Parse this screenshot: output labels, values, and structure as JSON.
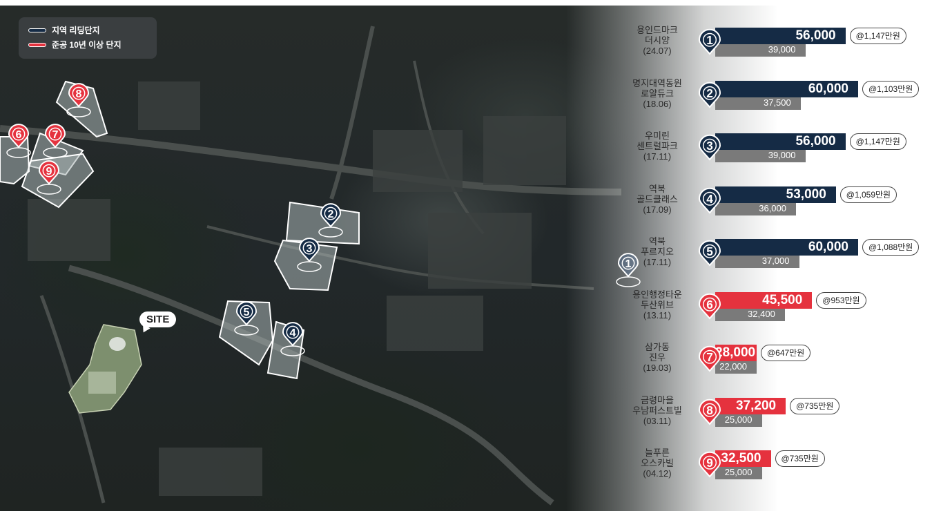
{
  "legend": {
    "items": [
      {
        "label": "지역 리딩단지",
        "color": "#152b45"
      },
      {
        "label": "준공 10년 이상 단지",
        "color": "#e5323e"
      }
    ]
  },
  "site_label": "SITE",
  "complexes": [
    {
      "num": "1",
      "name_lines": [
        "용인드마크",
        "더시양",
        "(24.07)"
      ],
      "price": "56,000",
      "sub": "39,000",
      "per_pyeong": "@1,147만원",
      "color": "navy"
    },
    {
      "num": "2",
      "name_lines": [
        "명지대역동원",
        "로얄듀크",
        "(18.06)"
      ],
      "price": "60,000",
      "sub": "37,500",
      "per_pyeong": "@1,103만원",
      "color": "navy"
    },
    {
      "num": "3",
      "name_lines": [
        "우미린",
        "센트럴파크",
        "(17.11)"
      ],
      "price": "56,000",
      "sub": "39,000",
      "per_pyeong": "@1,147만원",
      "color": "navy"
    },
    {
      "num": "4",
      "name_lines": [
        "역북",
        "골드클래스",
        "(17.09)"
      ],
      "price": "53,000",
      "sub": "36,000",
      "per_pyeong": "@1,059만원",
      "color": "navy"
    },
    {
      "num": "5",
      "name_lines": [
        "역북",
        "푸르지오",
        "(17.11)"
      ],
      "price": "60,000",
      "sub": "37,000",
      "per_pyeong": "@1,088만원",
      "color": "navy"
    },
    {
      "num": "6",
      "name_lines": [
        "용인행정타운",
        "두산위브",
        "(13.11)"
      ],
      "price": "45,500",
      "sub": "32,400",
      "per_pyeong": "@953만원",
      "color": "red"
    },
    {
      "num": "7",
      "name_lines": [
        "삼가동",
        "진우",
        "(19.03)"
      ],
      "price": "28,000",
      "sub": "22,000",
      "per_pyeong": "@647만원",
      "color": "red"
    },
    {
      "num": "8",
      "name_lines": [
        "금령마을",
        "우남퍼스트빌",
        "(03.11)"
      ],
      "price": "37,200",
      "sub": "25,000",
      "per_pyeong": "@735만원",
      "color": "red"
    },
    {
      "num": "9",
      "name_lines": [
        "늘푸른",
        "오스카빌",
        "(04.12)"
      ],
      "price": "32,500",
      "sub": "25,000",
      "per_pyeong": "@735만원",
      "color": "red"
    }
  ],
  "map_markers": [
    {
      "num": "1",
      "color": "navy"
    },
    {
      "num": "2",
      "color": "navy"
    },
    {
      "num": "3",
      "color": "navy"
    },
    {
      "num": "4",
      "color": "navy"
    },
    {
      "num": "5",
      "color": "navy"
    },
    {
      "num": "6",
      "color": "red"
    },
    {
      "num": "7",
      "color": "red"
    },
    {
      "num": "8",
      "color": "red"
    },
    {
      "num": "9",
      "color": "red"
    }
  ],
  "colors": {
    "navy": "#152b45",
    "red": "#e5323e",
    "gray": "#7a7a7a"
  }
}
